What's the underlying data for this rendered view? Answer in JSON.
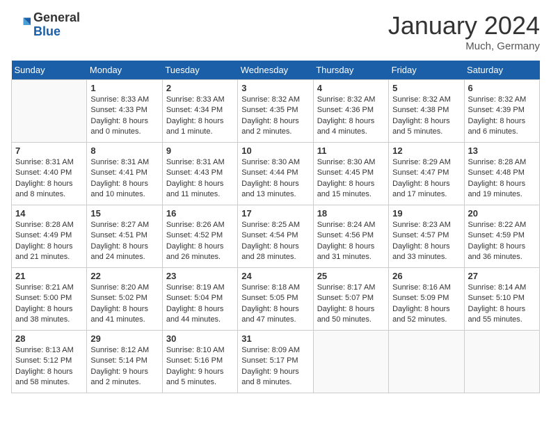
{
  "header": {
    "logo_general": "General",
    "logo_blue": "Blue",
    "month_title": "January 2024",
    "location": "Much, Germany"
  },
  "days_of_week": [
    "Sunday",
    "Monday",
    "Tuesday",
    "Wednesday",
    "Thursday",
    "Friday",
    "Saturday"
  ],
  "weeks": [
    [
      {
        "day": "",
        "info": ""
      },
      {
        "day": "1",
        "info": "Sunrise: 8:33 AM\nSunset: 4:33 PM\nDaylight: 8 hours\nand 0 minutes."
      },
      {
        "day": "2",
        "info": "Sunrise: 8:33 AM\nSunset: 4:34 PM\nDaylight: 8 hours\nand 1 minute."
      },
      {
        "day": "3",
        "info": "Sunrise: 8:32 AM\nSunset: 4:35 PM\nDaylight: 8 hours\nand 2 minutes."
      },
      {
        "day": "4",
        "info": "Sunrise: 8:32 AM\nSunset: 4:36 PM\nDaylight: 8 hours\nand 4 minutes."
      },
      {
        "day": "5",
        "info": "Sunrise: 8:32 AM\nSunset: 4:38 PM\nDaylight: 8 hours\nand 5 minutes."
      },
      {
        "day": "6",
        "info": "Sunrise: 8:32 AM\nSunset: 4:39 PM\nDaylight: 8 hours\nand 6 minutes."
      }
    ],
    [
      {
        "day": "7",
        "info": "Sunrise: 8:31 AM\nSunset: 4:40 PM\nDaylight: 8 hours\nand 8 minutes."
      },
      {
        "day": "8",
        "info": "Sunrise: 8:31 AM\nSunset: 4:41 PM\nDaylight: 8 hours\nand 10 minutes."
      },
      {
        "day": "9",
        "info": "Sunrise: 8:31 AM\nSunset: 4:43 PM\nDaylight: 8 hours\nand 11 minutes."
      },
      {
        "day": "10",
        "info": "Sunrise: 8:30 AM\nSunset: 4:44 PM\nDaylight: 8 hours\nand 13 minutes."
      },
      {
        "day": "11",
        "info": "Sunrise: 8:30 AM\nSunset: 4:45 PM\nDaylight: 8 hours\nand 15 minutes."
      },
      {
        "day": "12",
        "info": "Sunrise: 8:29 AM\nSunset: 4:47 PM\nDaylight: 8 hours\nand 17 minutes."
      },
      {
        "day": "13",
        "info": "Sunrise: 8:28 AM\nSunset: 4:48 PM\nDaylight: 8 hours\nand 19 minutes."
      }
    ],
    [
      {
        "day": "14",
        "info": "Sunrise: 8:28 AM\nSunset: 4:49 PM\nDaylight: 8 hours\nand 21 minutes."
      },
      {
        "day": "15",
        "info": "Sunrise: 8:27 AM\nSunset: 4:51 PM\nDaylight: 8 hours\nand 24 minutes."
      },
      {
        "day": "16",
        "info": "Sunrise: 8:26 AM\nSunset: 4:52 PM\nDaylight: 8 hours\nand 26 minutes."
      },
      {
        "day": "17",
        "info": "Sunrise: 8:25 AM\nSunset: 4:54 PM\nDaylight: 8 hours\nand 28 minutes."
      },
      {
        "day": "18",
        "info": "Sunrise: 8:24 AM\nSunset: 4:56 PM\nDaylight: 8 hours\nand 31 minutes."
      },
      {
        "day": "19",
        "info": "Sunrise: 8:23 AM\nSunset: 4:57 PM\nDaylight: 8 hours\nand 33 minutes."
      },
      {
        "day": "20",
        "info": "Sunrise: 8:22 AM\nSunset: 4:59 PM\nDaylight: 8 hours\nand 36 minutes."
      }
    ],
    [
      {
        "day": "21",
        "info": "Sunrise: 8:21 AM\nSunset: 5:00 PM\nDaylight: 8 hours\nand 38 minutes."
      },
      {
        "day": "22",
        "info": "Sunrise: 8:20 AM\nSunset: 5:02 PM\nDaylight: 8 hours\nand 41 minutes."
      },
      {
        "day": "23",
        "info": "Sunrise: 8:19 AM\nSunset: 5:04 PM\nDaylight: 8 hours\nand 44 minutes."
      },
      {
        "day": "24",
        "info": "Sunrise: 8:18 AM\nSunset: 5:05 PM\nDaylight: 8 hours\nand 47 minutes."
      },
      {
        "day": "25",
        "info": "Sunrise: 8:17 AM\nSunset: 5:07 PM\nDaylight: 8 hours\nand 50 minutes."
      },
      {
        "day": "26",
        "info": "Sunrise: 8:16 AM\nSunset: 5:09 PM\nDaylight: 8 hours\nand 52 minutes."
      },
      {
        "day": "27",
        "info": "Sunrise: 8:14 AM\nSunset: 5:10 PM\nDaylight: 8 hours\nand 55 minutes."
      }
    ],
    [
      {
        "day": "28",
        "info": "Sunrise: 8:13 AM\nSunset: 5:12 PM\nDaylight: 8 hours\nand 58 minutes."
      },
      {
        "day": "29",
        "info": "Sunrise: 8:12 AM\nSunset: 5:14 PM\nDaylight: 9 hours\nand 2 minutes."
      },
      {
        "day": "30",
        "info": "Sunrise: 8:10 AM\nSunset: 5:16 PM\nDaylight: 9 hours\nand 5 minutes."
      },
      {
        "day": "31",
        "info": "Sunrise: 8:09 AM\nSunset: 5:17 PM\nDaylight: 9 hours\nand 8 minutes."
      },
      {
        "day": "",
        "info": ""
      },
      {
        "day": "",
        "info": ""
      },
      {
        "day": "",
        "info": ""
      }
    ]
  ]
}
